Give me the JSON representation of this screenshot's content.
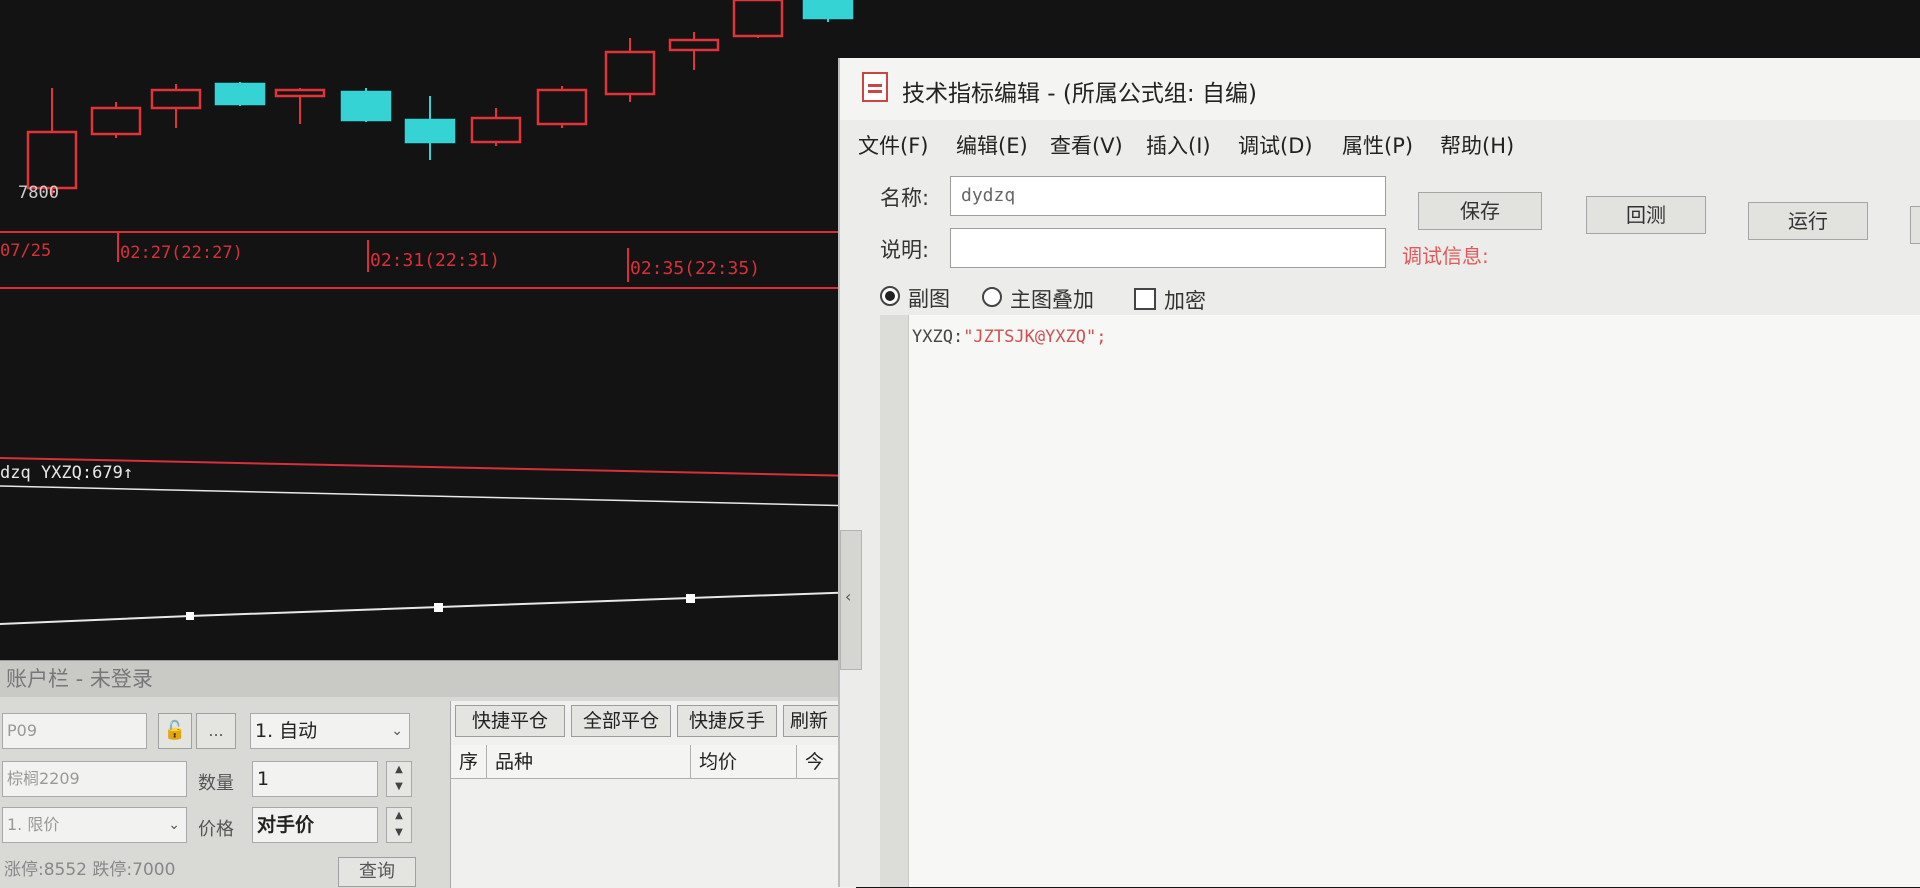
{
  "chart": {
    "price_label": "7800",
    "time_labels": [
      "07/25",
      "02:27(22:27)",
      "02:31(22:31)",
      "02:35(22:35)"
    ],
    "indicator_label": "dzq YXZQ:679↑",
    "colors": {
      "up": "#e0343a",
      "down": "#35d3d3",
      "grid": "#d8303a",
      "line": "#e8e8e8"
    }
  },
  "account": {
    "title": "账户栏 - 未登录",
    "account_code": "P09",
    "more_label": "...",
    "mode_select": "1. 自动",
    "contract": "棕榈2209",
    "quantity_label": "数量",
    "quantity": "1",
    "order_type_select": "1. 限价",
    "price_label": "价格",
    "price_value": "对手价",
    "limits_text": "涨停:8552 跌停:7000",
    "query_button": "查询"
  },
  "positions": {
    "buttons": [
      "快捷平仓",
      "全部平仓",
      "快捷反手",
      "刷新"
    ],
    "columns": [
      "序",
      "品种",
      "均价",
      "今"
    ]
  },
  "editor": {
    "title": "技术指标编辑 - (所属公式组: 自编)",
    "menu": [
      "文件(F)",
      "编辑(E)",
      "查看(V)",
      "插入(I)",
      "调试(D)",
      "属性(P)",
      "帮助(H)"
    ],
    "name_label": "名称:",
    "name_value": "dydzq",
    "desc_label": "说明:",
    "desc_value": "",
    "buttons": {
      "save": "保存",
      "backtest": "回测",
      "run": "运行"
    },
    "debug_label": "调试信息:",
    "options": {
      "sub_chart": "副图",
      "main_overlay": "主图叠加",
      "encrypt": "加密"
    },
    "code": {
      "name": "YXZQ:",
      "value": "\"JZTSJK@YXZQ\";"
    },
    "splitter_glyph": "‹"
  }
}
